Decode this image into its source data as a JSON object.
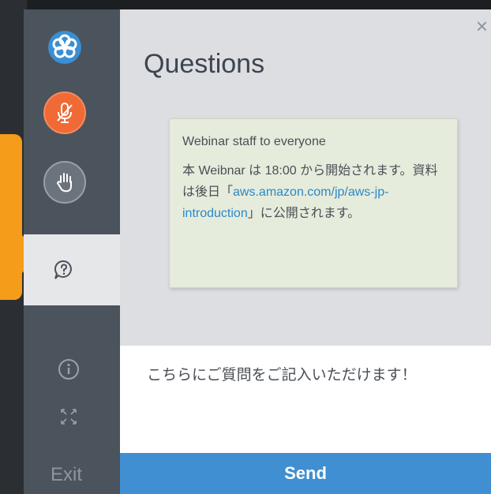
{
  "panel": {
    "title": "Questions",
    "close_glyph": "×"
  },
  "message": {
    "sender": "Webinar staff to everyone",
    "body_pre": "本 Weibnar は 18:00 から開始されます。資料は後日「",
    "link_text": "aws.amazon.com/jp/aws-jp-introduction",
    "body_post": "」に公開されます。"
  },
  "input": {
    "value": "こちらにご質問をご記入いただけます！"
  },
  "send_button": {
    "label": "Send"
  },
  "sidebar": {
    "exit_label": "Exit",
    "icons": [
      "logo-icon",
      "microphone-muted-icon",
      "raise-hand-icon",
      "question-chat-icon",
      "info-icon",
      "expand-icon"
    ]
  },
  "colors": {
    "sidebar": "#4b535d",
    "mic_active": "#f06a35",
    "send": "#3f8fd2",
    "callout": "#f59c1a",
    "message_card": "#e5ecdc",
    "link": "#2d87c7"
  }
}
